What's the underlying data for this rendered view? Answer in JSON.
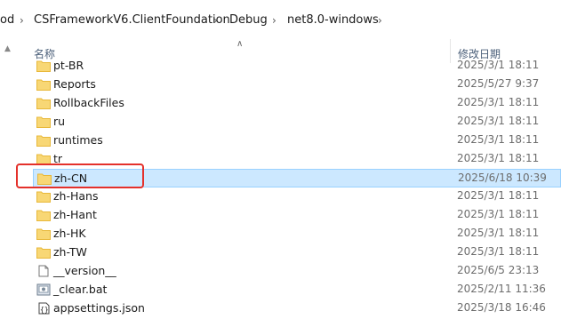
{
  "breadcrumb": [
    "od",
    "CSFrameworkV6.ClientFoundation",
    "Debug",
    "net8.0-windows"
  ],
  "columns": {
    "name": "名称",
    "date": "修改日期"
  },
  "files": [
    {
      "name": "pt-BR",
      "date": "2025/3/1 18:11",
      "type": "folder"
    },
    {
      "name": "Reports",
      "date": "2025/5/27 9:37",
      "type": "folder"
    },
    {
      "name": "RollbackFiles",
      "date": "2025/3/1 18:11",
      "type": "folder"
    },
    {
      "name": "ru",
      "date": "2025/3/1 18:11",
      "type": "folder"
    },
    {
      "name": "runtimes",
      "date": "2025/3/1 18:11",
      "type": "folder"
    },
    {
      "name": "tr",
      "date": "2025/3/1 18:11",
      "type": "folder"
    },
    {
      "name": "zh-CN",
      "date": "2025/6/18 10:39",
      "type": "folder",
      "selected": true
    },
    {
      "name": "zh-Hans",
      "date": "2025/3/1 18:11",
      "type": "folder"
    },
    {
      "name": "zh-Hant",
      "date": "2025/3/1 18:11",
      "type": "folder"
    },
    {
      "name": "zh-HK",
      "date": "2025/3/1 18:11",
      "type": "folder"
    },
    {
      "name": "zh-TW",
      "date": "2025/3/1 18:11",
      "type": "folder"
    },
    {
      "name": "__version__",
      "date": "2025/6/5 23:13",
      "type": "file"
    },
    {
      "name": "_clear.bat",
      "date": "2025/2/11 11:36",
      "type": "bat"
    },
    {
      "name": "appsettings.json",
      "date": "2025/3/18 16:46",
      "type": "json"
    }
  ],
  "colors": {
    "folder": "#f8d775",
    "folder_dark": "#e8b83a",
    "selected": "#cce8ff",
    "highlight": "#e4312b"
  }
}
